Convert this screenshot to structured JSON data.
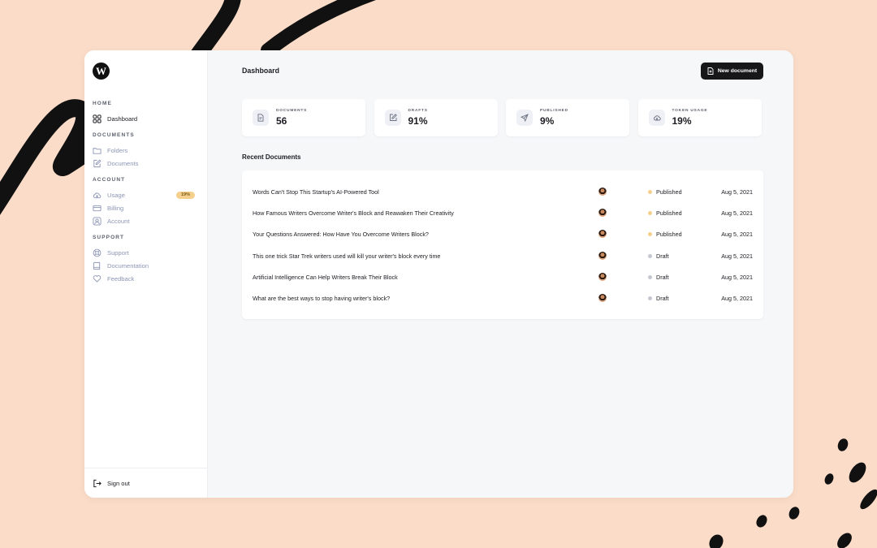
{
  "sidebar": {
    "logo_letter": "W",
    "sections": [
      {
        "title": "HOME",
        "items": [
          {
            "label": "Dashboard",
            "icon": "grid-icon",
            "active": true
          }
        ]
      },
      {
        "title": "DOCUMENTS",
        "items": [
          {
            "label": "Folders",
            "icon": "folder-icon"
          },
          {
            "label": "Documents",
            "icon": "edit-icon"
          }
        ]
      },
      {
        "title": "ACCOUNT",
        "items": [
          {
            "label": "Usage",
            "icon": "cloud-icon",
            "badge": "19%"
          },
          {
            "label": "Billing",
            "icon": "credit-card-icon"
          },
          {
            "label": "Account",
            "icon": "user-icon"
          }
        ]
      },
      {
        "title": "SUPPORT",
        "items": [
          {
            "label": "Support",
            "icon": "lifebuoy-icon"
          },
          {
            "label": "Documentation",
            "icon": "book-icon"
          },
          {
            "label": "Feedback",
            "icon": "heart-icon"
          }
        ]
      }
    ],
    "sign_out_label": "Sign out"
  },
  "header": {
    "title": "Dashboard",
    "new_document_label": "New document"
  },
  "stats": [
    {
      "label": "DOCUMENTS",
      "value": "56",
      "icon": "file-icon"
    },
    {
      "label": "DRAFTS",
      "value": "91%",
      "icon": "edit-icon"
    },
    {
      "label": "PUBLISHED",
      "value": "9%",
      "icon": "send-icon"
    },
    {
      "label": "TOKEN USAGE",
      "value": "19%",
      "icon": "cloud-icon"
    }
  ],
  "recent": {
    "heading": "Recent Documents",
    "rows": [
      {
        "title": "Words Can't Stop This Startup's AI-Powered Tool",
        "status": "Published",
        "date": "Aug 5, 2021"
      },
      {
        "title": "How Famous Writers Overcome Writer's Block and Reawaken Their Creativity",
        "status": "Published",
        "date": "Aug 5, 2021"
      },
      {
        "title": "Your Questions Answered: How Have You Overcome Writers Block?",
        "status": "Published",
        "date": "Aug 5, 2021"
      },
      {
        "title": "This one trick Star Trek writers used will kill your writer's block every time",
        "status": "Draft",
        "date": "Aug 5, 2021"
      },
      {
        "title": "Artificial Intelligence Can Help Writers Break Their Block",
        "status": "Draft",
        "date": "Aug 5, 2021"
      },
      {
        "title": "What are the best ways to stop having writer's block?",
        "status": "Draft",
        "date": "Aug 5, 2021"
      }
    ]
  },
  "colors": {
    "background": "#fadcc8",
    "published_dot": "#f5d08c",
    "draft_dot": "#c4c7cf",
    "button_dark": "#17171a"
  }
}
